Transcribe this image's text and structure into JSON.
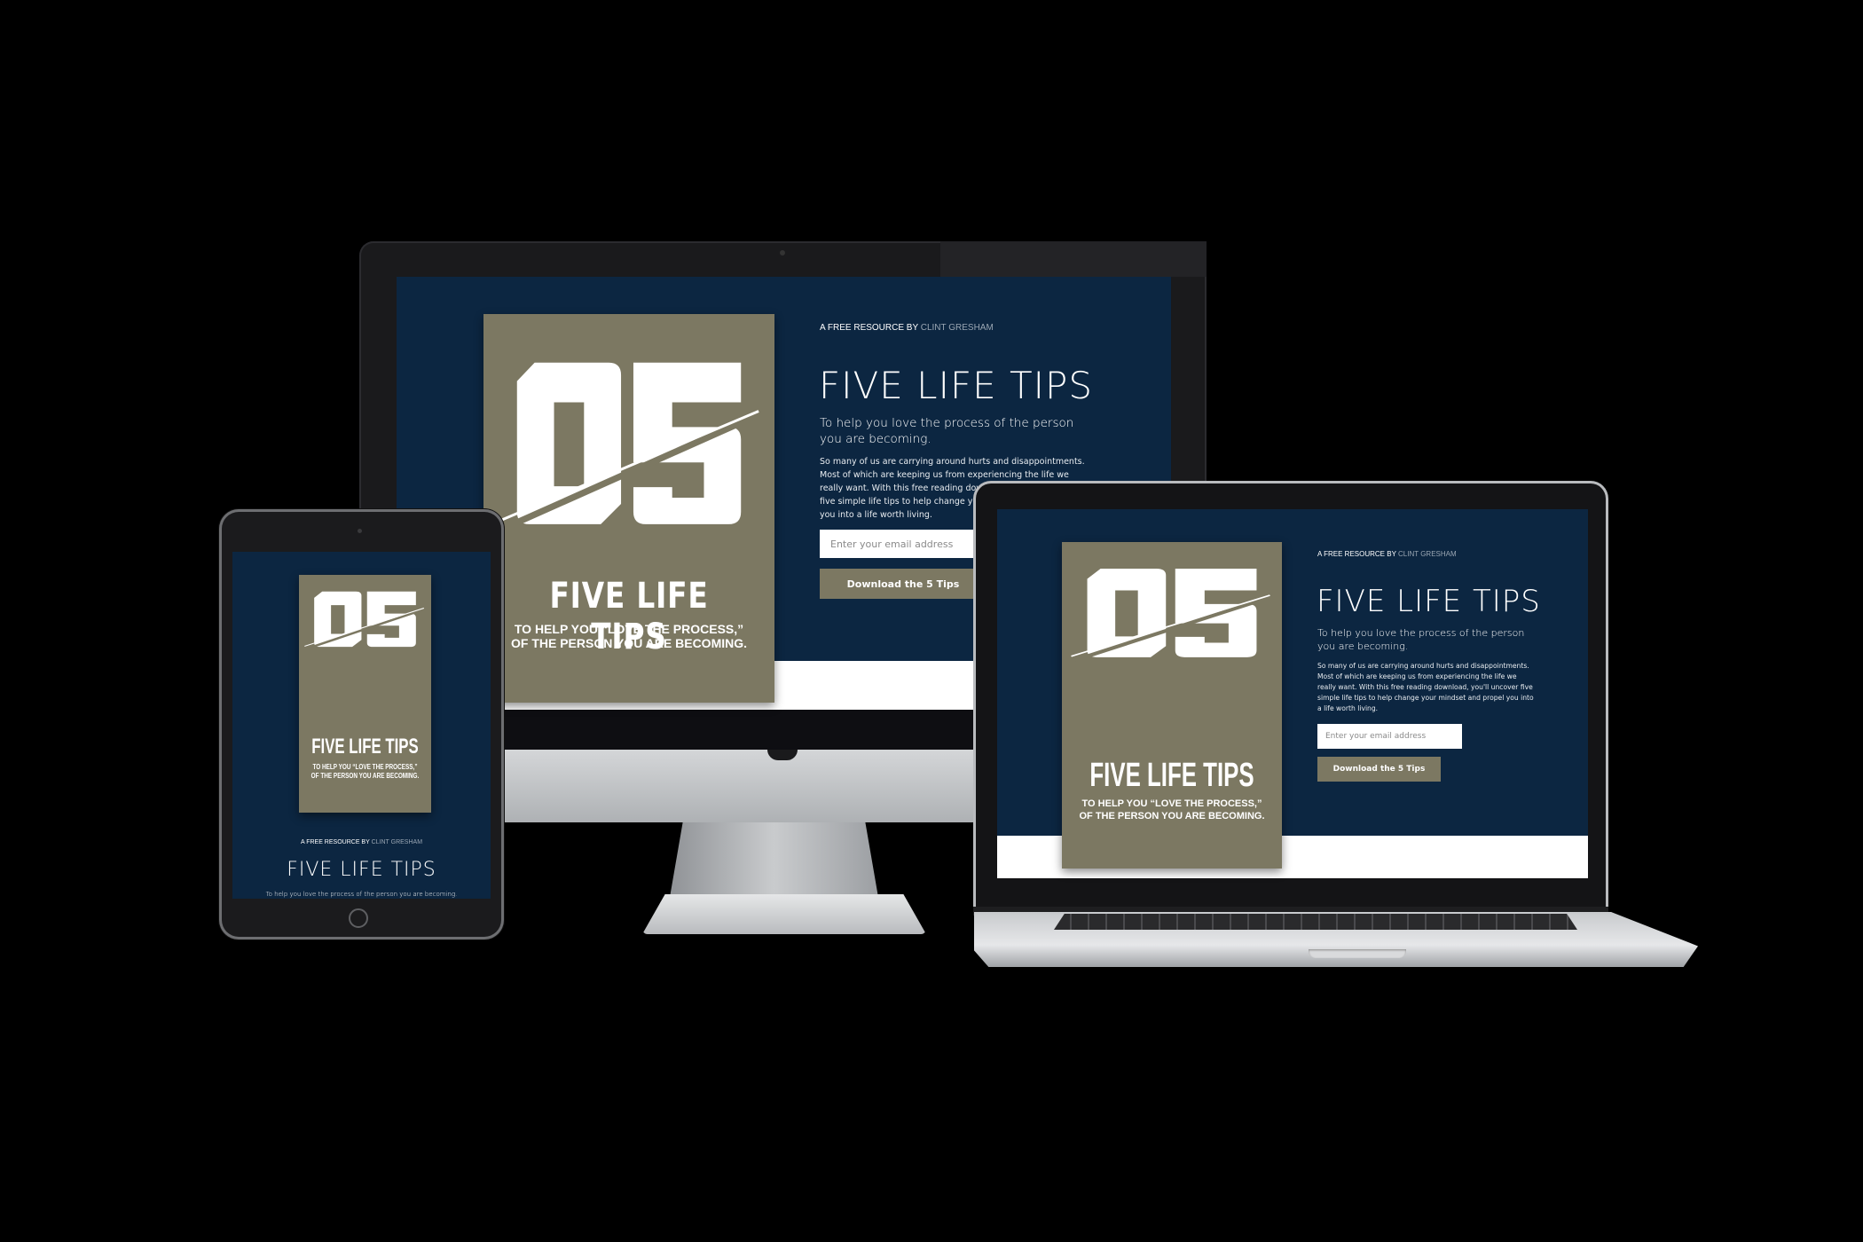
{
  "page": {
    "kicker_prefix": "A FREE RESOURCE BY",
    "author": "CLINT GRESHAM",
    "title": "FIVE LIFE TIPS",
    "subtitle": "To help you love the process of the person you are becoming.",
    "body": "So many of us are carrying around hurts and disappointments. Most of which are keeping us from experiencing the life we really want. With this free reading download, you'll uncover five simple life tips to help change your mindset and propel you into a life worth living.",
    "email_placeholder": "Enter your email address",
    "button_label": "Download the 5 Tips"
  },
  "book_cover": {
    "number": "05",
    "title": "FIVE LIFE TIPS",
    "tagline_line1": "TO HELP YOU “LOVE THE PROCESS,”",
    "tagline_line2": "OF THE PERSON YOU ARE BECOMING."
  },
  "colors": {
    "background": "#000000",
    "page_navy": "#0c2641",
    "cover_tan": "#7c7862",
    "text_white": "#ffffff",
    "author_gray": "#9aa6b3"
  },
  "icons": {
    "tablet_home_button": "circle-button-icon",
    "camera": "camera-dot-icon"
  }
}
